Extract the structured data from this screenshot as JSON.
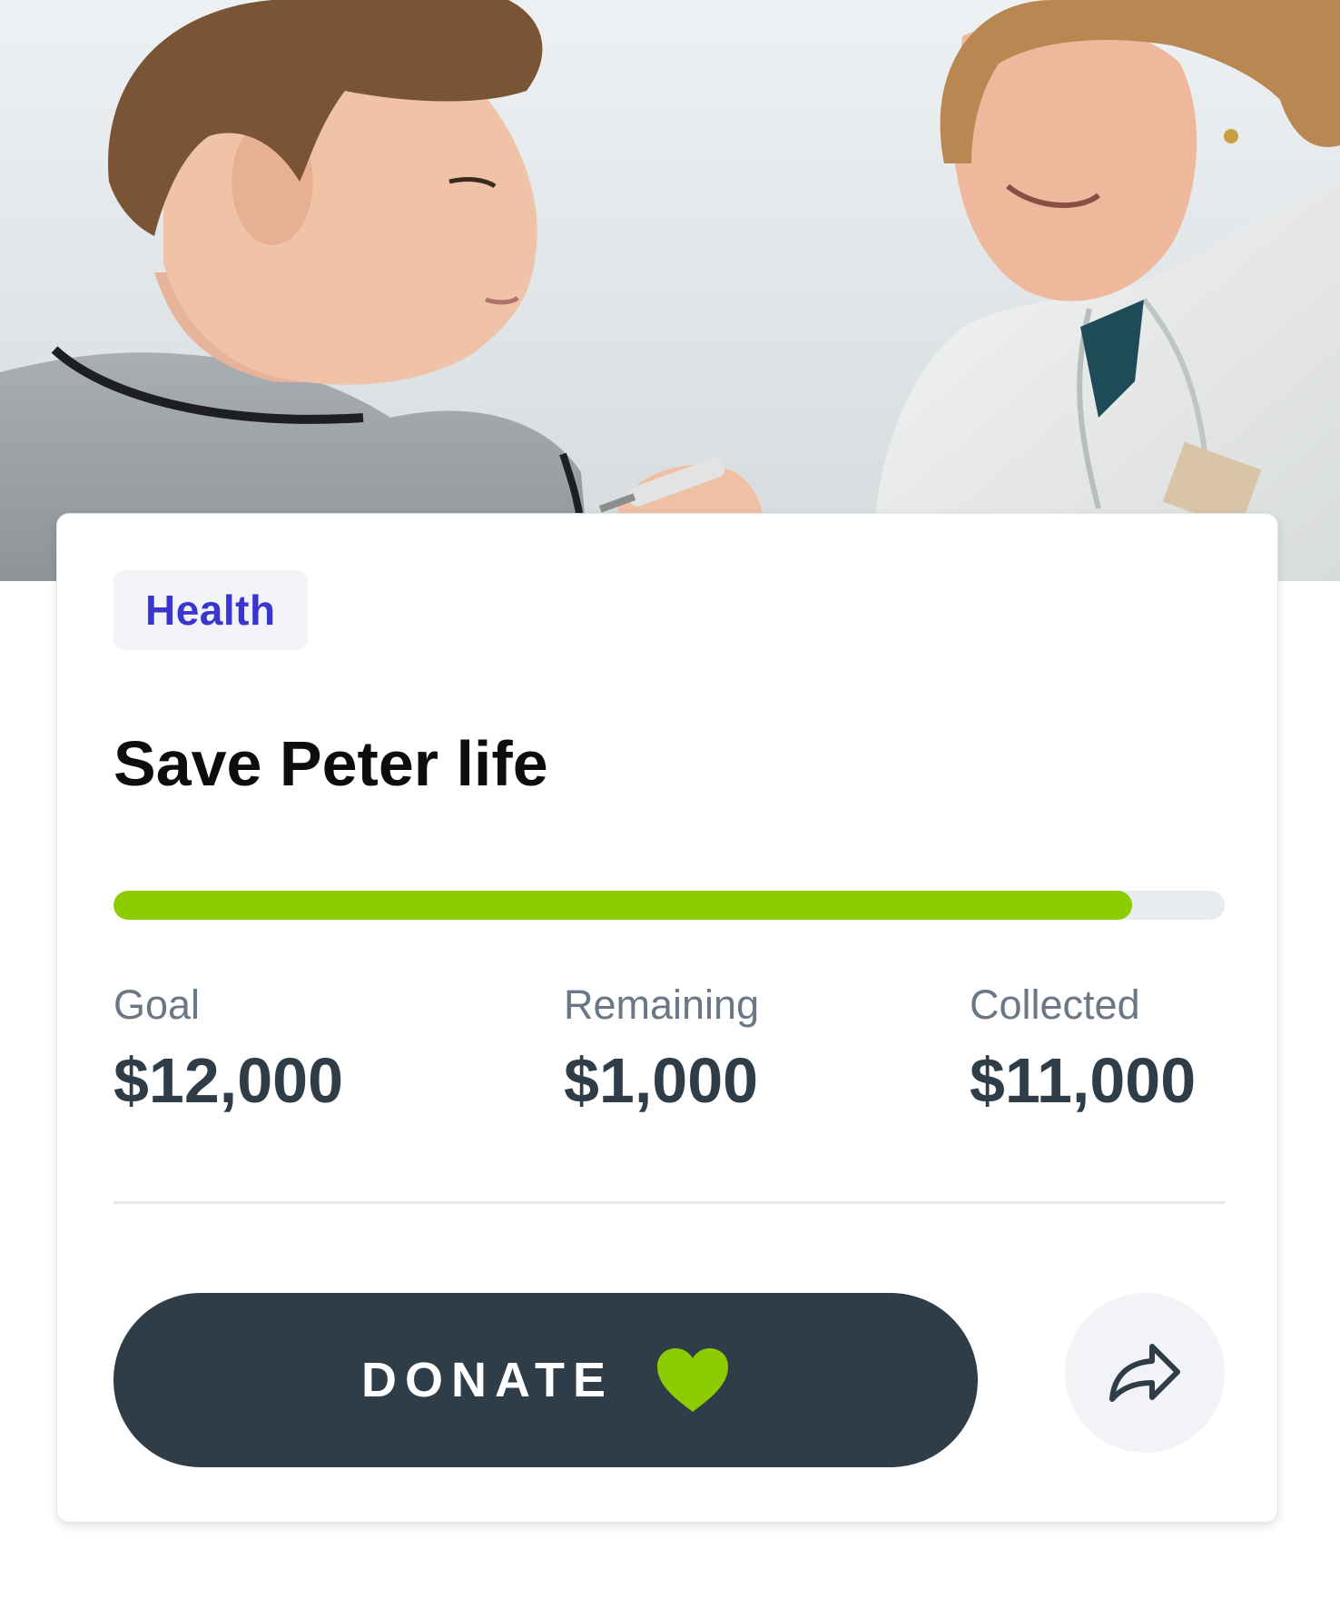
{
  "campaign": {
    "category": "Health",
    "title": "Save Peter life",
    "progress_fraction": 0.9167,
    "stats": {
      "goal_label": "Goal",
      "goal_value": "$12,000",
      "remaining_label": "Remaining",
      "remaining_value": "$1,000",
      "collected_label": "Collected",
      "collected_value": "$11,000"
    }
  },
  "actions": {
    "donate_label": "DONATE",
    "donate_icon": "heart-icon",
    "share_icon": "share-icon"
  },
  "colors": {
    "accent_green": "#8dcc00",
    "button_dark": "#2e3d48",
    "tag_text": "#3a35cf",
    "tag_bg": "#f1f3f6"
  }
}
